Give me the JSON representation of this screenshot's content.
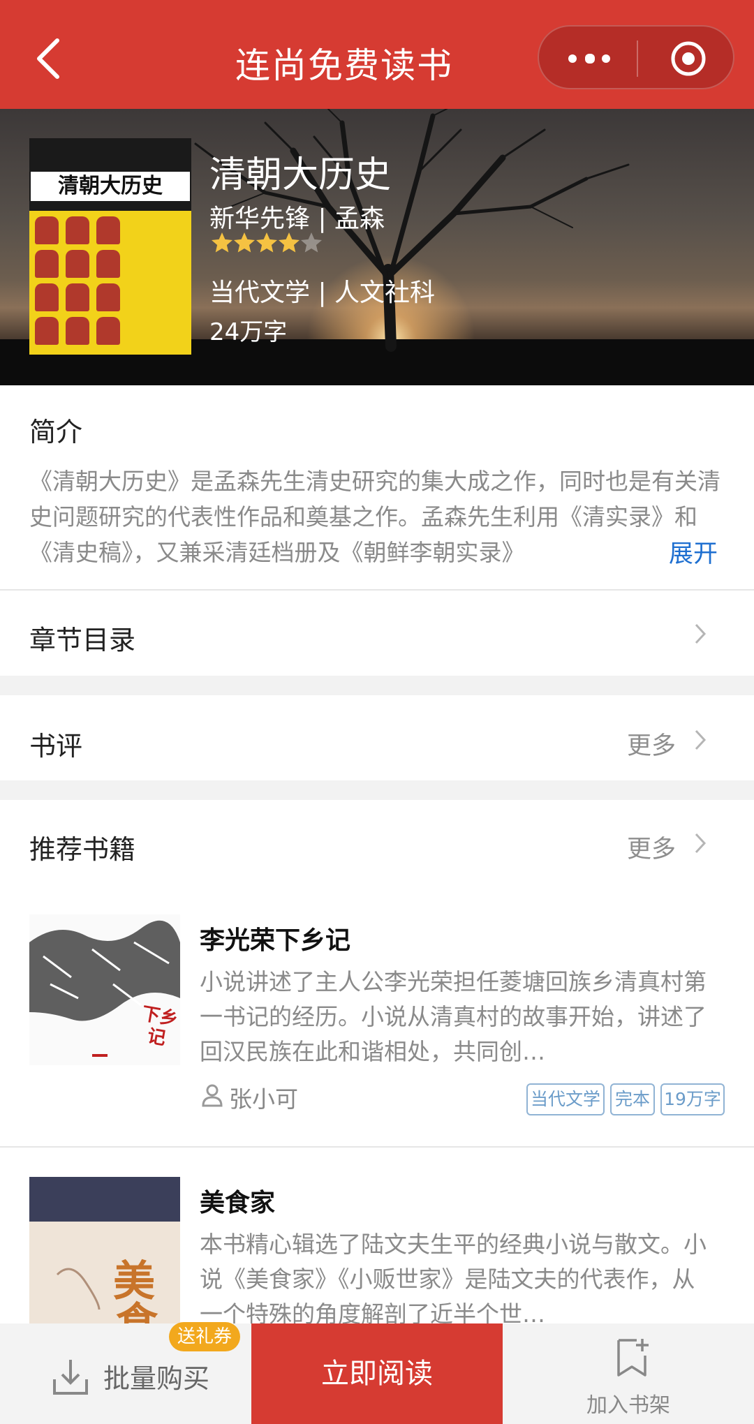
{
  "nav": {
    "title": "连尚免费读书"
  },
  "book": {
    "title": "清朝大历史",
    "author_line": "新华先锋 | 孟森",
    "rating": 4,
    "rating_max": 5,
    "category_line": "当代文学 | 人文社科",
    "word_count": "24万字",
    "cover_title": "清朝大历史"
  },
  "intro": {
    "heading": "简介",
    "text": "《清朝大历史》是孟森先生清史研究的集大成之作，同时也是有关清史问题研究的代表性作品和奠基之作。孟森先生利用《清实录》和《清史稿》，又兼采清廷档册及《朝鲜李朝实录》",
    "expand_label": "展开"
  },
  "chapters": {
    "label": "章节目录"
  },
  "reviews": {
    "label": "书评",
    "more_label": "更多"
  },
  "recommend": {
    "heading": "推荐书籍",
    "more_label": "更多",
    "books": [
      {
        "title": "李光荣下乡记",
        "description": "小说讲述了主人公李光荣担任菱塘回族乡清真村第一书记的经历。小说从清真村的故事开始，讲述了回汉民族在此和谐相处，共同创…",
        "author": "张小可",
        "tags": [
          "当代文学",
          "完本",
          "19万字"
        ]
      },
      {
        "title": "美食家",
        "description": "本书精心辑选了陆文夫生平的经典小说与散文。小说《美食家》《小贩世家》是陆文夫的代表作，从一个特殊的角度解剖了近半个世…",
        "author": "",
        "tags": []
      }
    ]
  },
  "bottom": {
    "batch_label": "批量购买",
    "gift_badge": "送礼券",
    "read_label": "立即阅读",
    "shelf_label": "加入书架"
  },
  "colors": {
    "brand_red": "#d63b32",
    "link_blue": "#1e6fd0",
    "tag_blue": "#6b9cc9",
    "gift_orange": "#f2a81d",
    "star_gold": "#f5c242"
  }
}
